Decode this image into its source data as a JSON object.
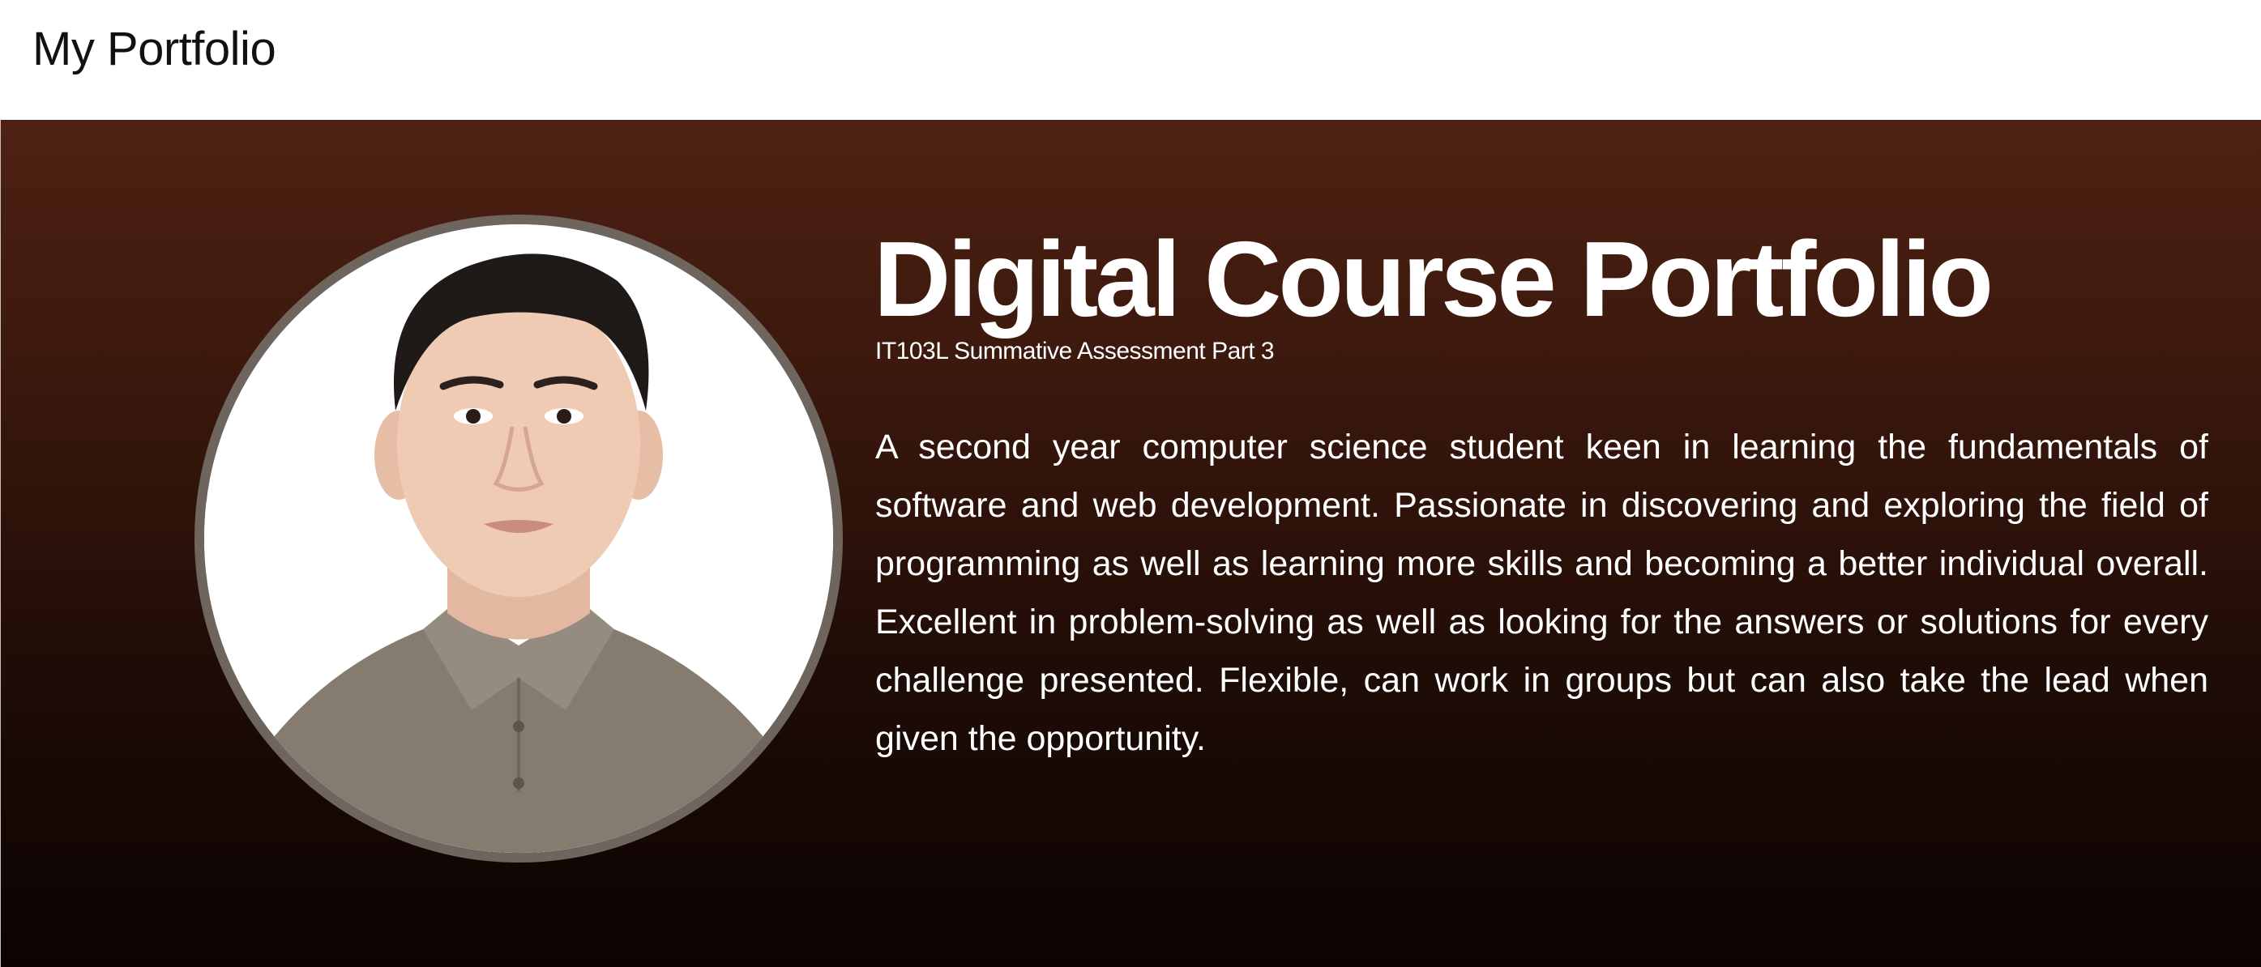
{
  "navbar": {
    "brand": "My Portfolio"
  },
  "hero": {
    "title": "Digital Course Portfolio",
    "subtitle": "IT103L Summative Assessment Part 3",
    "bio": "A second year computer science student keen in learning the fundamentals of software and web development. Passionate in discovering and exploring the field of programming as well as learning more skills and becoming a better individual overall. Excellent in problem-solving as well as looking for the answers or solutions for every challenge presented. Flexible, can work in groups but can also take the lead when given the opportunity.",
    "photo": "profile-photo"
  },
  "colors": {
    "hero_top": "#4e2113",
    "hero_bottom": "#0b0302",
    "photo_ring": "#6e655f",
    "text": "#ffffff"
  }
}
